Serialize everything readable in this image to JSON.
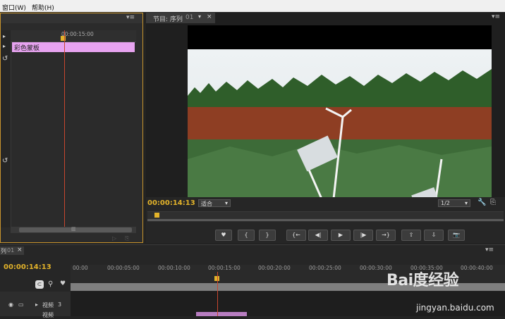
{
  "menu": {
    "items": [
      "窗口(W)",
      "帮助(H)"
    ]
  },
  "effect_controls": {
    "ruler_time": "00:00:15:00",
    "clip_label": "彩色蒙板",
    "scroll_marker": "▥"
  },
  "program_monitor": {
    "tab_label": "节目: 序列",
    "sequence_name": "01",
    "timecode": "00:00:14:13",
    "fit_option": "适合",
    "resolution": "1/2",
    "controls": [
      "♥",
      "{",
      "}",
      "{←",
      "◀|",
      "▶",
      "|▶",
      "→}",
      "⇧",
      "⇩",
      "📷"
    ]
  },
  "timeline": {
    "tab_label": "列",
    "tab_sequence": "01",
    "timecode": "00:00:14:13",
    "ruler_ticks": [
      "00:00",
      "00:00:05:00",
      "00:00:10:00",
      "00:00:15:00",
      "00:00:20:00",
      "00:00:25:00",
      "00:00:30:00",
      "00:00:35:00",
      "00:00:40:00"
    ],
    "track_label": "视频",
    "track_number": "3",
    "track_label_2": "视频"
  },
  "watermark": {
    "brand": "Bai度经验",
    "url": "jingyan.baidu.com"
  },
  "colors": {
    "accent": "#e3b32a",
    "playhead": "#c8462e",
    "clip": "#e7a3f0"
  }
}
